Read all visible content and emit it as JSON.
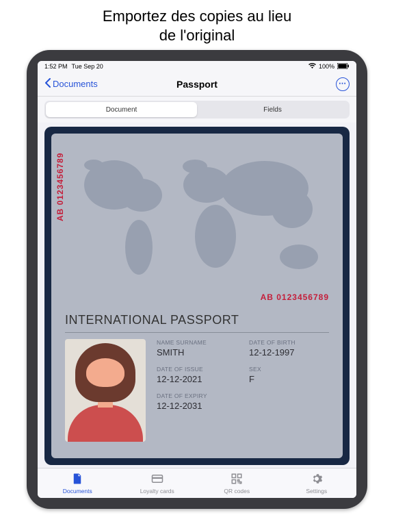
{
  "heading": {
    "line1": "Emportez des copies au lieu",
    "line2": "de l'original"
  },
  "status": {
    "time": "1:52 PM",
    "date": "Tue Sep 20",
    "battery": "100%"
  },
  "nav": {
    "back": "Documents",
    "title": "Passport"
  },
  "segments": {
    "document": "Document",
    "fields": "Fields"
  },
  "passport": {
    "serial_vertical": "AB 0123456789",
    "serial_horizontal": "AB 0123456789",
    "title": "INTERNATIONAL PASSPORT",
    "fields": {
      "name_label": "NAME SURNAME",
      "name_value": "SMITH",
      "dob_label": "DATE OF BIRTH",
      "dob_value": "12-12-1997",
      "issue_label": "DATE OF ISSUE",
      "issue_value": "12-12-2021",
      "sex_label": "SEX",
      "sex_value": "F",
      "expiry_label": "DATE OF EXPIRY",
      "expiry_value": "12-12-2031"
    }
  },
  "tabs": {
    "documents": "Documents",
    "loyalty": "Loyalty cards",
    "qr": "QR codes",
    "settings": "Settings"
  }
}
